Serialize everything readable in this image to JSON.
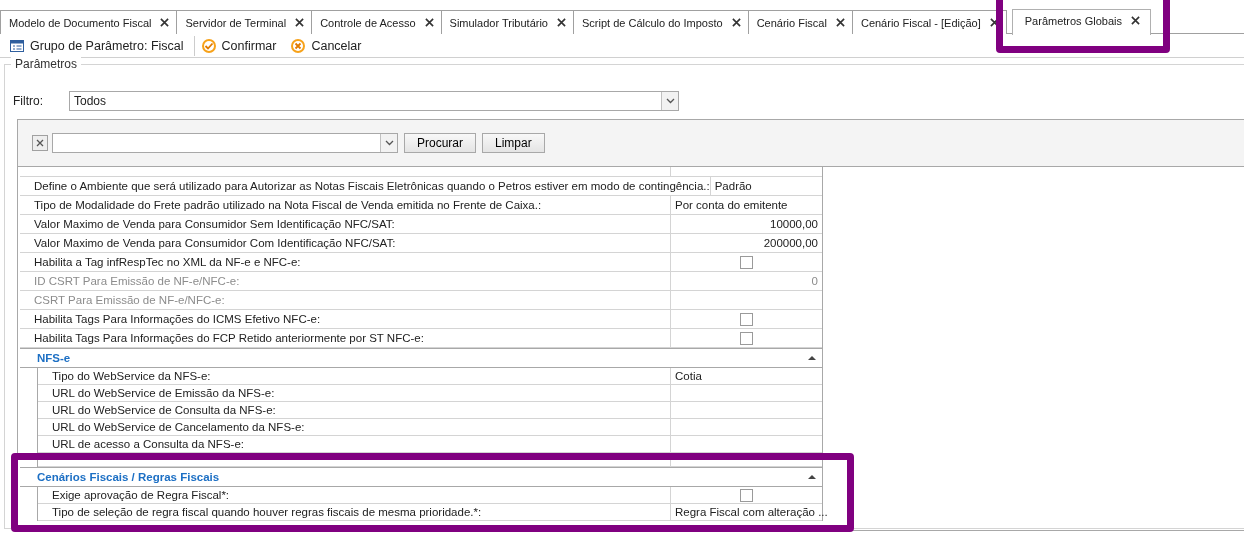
{
  "tabs": [
    {
      "label": "Modelo de Documento Fiscal",
      "selected": false,
      "highlighted": false
    },
    {
      "label": "Servidor de Terminal",
      "selected": false,
      "highlighted": false
    },
    {
      "label": "Controle de Acesso",
      "selected": false,
      "highlighted": false
    },
    {
      "label": "Simulador Tributário",
      "selected": false,
      "highlighted": false
    },
    {
      "label": "Script de Cálculo do Imposto",
      "selected": false,
      "highlighted": false
    },
    {
      "label": "Cenário Fiscal",
      "selected": false,
      "highlighted": false
    },
    {
      "label": "Cenário Fiscal - [Edição]",
      "selected": false,
      "highlighted": false
    },
    {
      "label": "Parâmetros Globais",
      "selected": true,
      "highlighted": true
    }
  ],
  "toolbar": {
    "group_label": "Grupo de Parâmetro: Fiscal",
    "buttons": [
      {
        "kind": "confirm",
        "label": "Confirmar"
      },
      {
        "kind": "cancel",
        "label": "Cancelar"
      }
    ]
  },
  "panel": {
    "title": "Parâmetros",
    "filter": {
      "label": "Filtro:",
      "value": "Todos"
    },
    "search": {
      "buttons": [
        "Procurar",
        "Limpar"
      ]
    },
    "rows": [
      {
        "label": "Define o Ambiente que será utilizado para Autorizar as Notas Fiscais Eletrônicas quando o Petros estiver em modo de contingência.:",
        "kind": "text",
        "value": "Padrão",
        "disabled": false
      },
      {
        "label": "Tipo de Modalidade do Frete padrão utilizado na Nota Fiscal de Venda emitida no Frente de Caixa.:",
        "kind": "text",
        "value": "Por conta do emitente",
        "disabled": false
      },
      {
        "label": "Valor Maximo de Venda para Consumidor Sem Identificação NFC/SAT:",
        "kind": "number",
        "value": "10000,00",
        "disabled": false
      },
      {
        "label": "Valor Maximo de Venda para Consumidor Com Identificação NFC/SAT:",
        "kind": "number",
        "value": "200000,00",
        "disabled": false
      },
      {
        "label": "Habilita a Tag infRespTec no XML da NF-e e NFC-e:",
        "kind": "checkbox",
        "checked": false,
        "disabled": false
      },
      {
        "label": "ID CSRT Para Emissão de NF-e/NFC-e:",
        "kind": "number",
        "value": "0",
        "disabled": true
      },
      {
        "label": "CSRT Para Emissão de NF-e/NFC-e:",
        "kind": "empty",
        "disabled": true
      },
      {
        "label": "Habilita Tags Para Informações do ICMS Efetivo NFC-e:",
        "kind": "checkbox",
        "checked": false,
        "disabled": false
      },
      {
        "label": "Habilita Tags Para Informações do FCP Retido anteriormente por ST NFC-e:",
        "kind": "checkbox",
        "checked": false,
        "disabled": false
      }
    ],
    "sections": [
      {
        "title": "NFS-e",
        "expanded": true,
        "highlighted": false,
        "rows": [
          {
            "label": "Tipo do WebService da NFS-e:",
            "kind": "text",
            "value": "Cotia",
            "disabled": false
          },
          {
            "label": "URL do WebService de Emissão da NFS-e:",
            "kind": "empty",
            "disabled": false
          },
          {
            "label": "URL do WebService de Consulta da NFS-e:",
            "kind": "empty",
            "disabled": false
          },
          {
            "label": "URL do WebService de Cancelamento da NFS-e:",
            "kind": "empty",
            "disabled": false
          },
          {
            "label": "URL de acesso a Consulta da NFS-e:",
            "kind": "empty",
            "disabled": false
          }
        ]
      },
      {
        "title": "Cenários Fiscais / Regras Fiscais",
        "expanded": true,
        "highlighted": true,
        "rows": [
          {
            "label": "Exige aprovação de Regra Fiscal*:",
            "kind": "checkbox",
            "checked": false,
            "disabled": false
          },
          {
            "label": "Tipo de seleção de regra fiscal quando houver regras fiscais de mesma prioridade.*:",
            "kind": "text",
            "value": "Regra Fiscal com alteração ...",
            "disabled": false
          }
        ]
      }
    ]
  }
}
